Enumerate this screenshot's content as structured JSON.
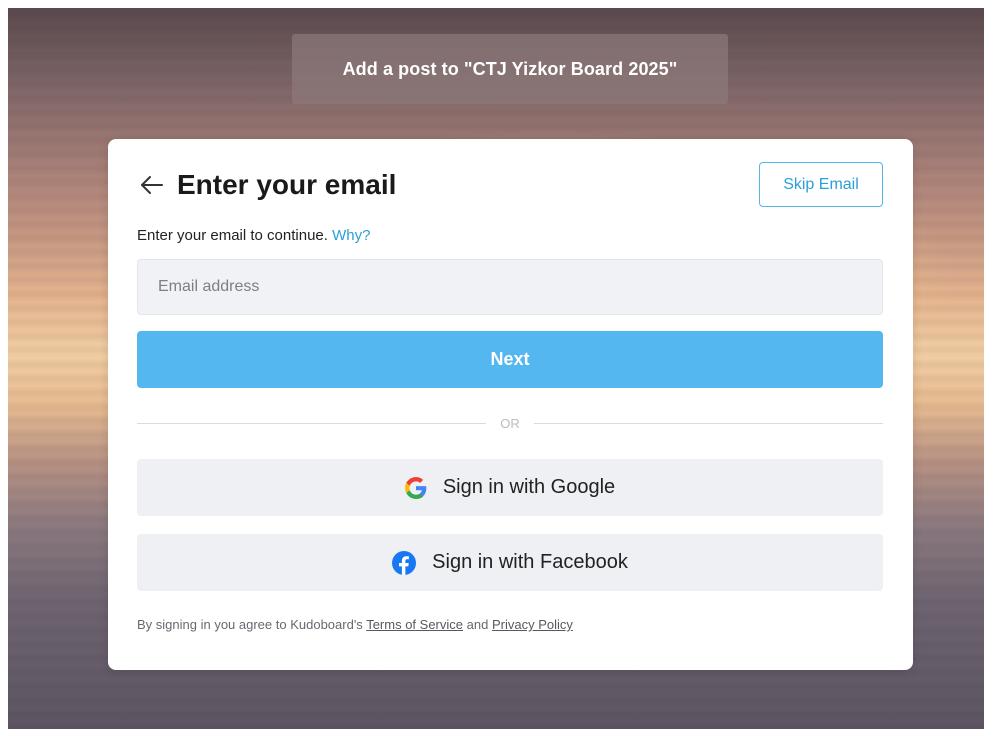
{
  "banner": {
    "text": "Add a post to  \"CTJ Yizkor Board 2025\""
  },
  "dialog": {
    "title": "Enter your email",
    "skip_label": "Skip Email",
    "subtitle": "Enter your email to continue.",
    "why_link": "Why?",
    "email_placeholder": "Email address",
    "email_value": "",
    "next_label": "Next",
    "divider_text": "OR",
    "google_label": "Sign in with Google",
    "facebook_label": "Sign in with Facebook",
    "terms_prefix": "By signing in you agree to Kudoboard's",
    "terms_link": "Terms of Service",
    "terms_and": "and",
    "privacy_link": "Privacy Policy"
  },
  "colors": {
    "accent": "#54b7ef",
    "link": "#2a9fd8",
    "facebook": "#1877f2"
  },
  "icons": {
    "back": "arrow-left-icon",
    "google": "google-g-icon",
    "facebook": "facebook-icon"
  }
}
